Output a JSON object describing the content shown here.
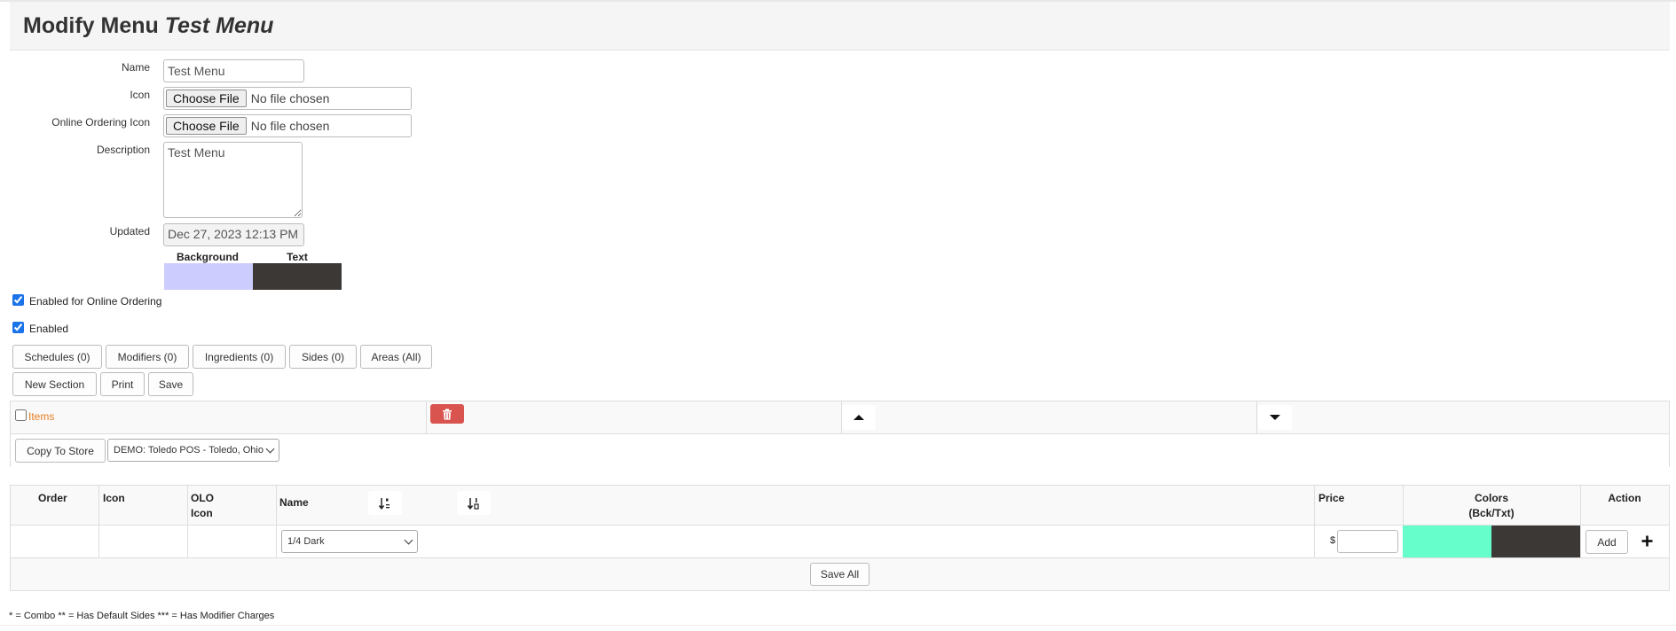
{
  "header": {
    "title_prefix": "Modify Menu",
    "title_name": "Test Menu"
  },
  "form": {
    "name_label": "Name",
    "name_value": "Test Menu",
    "icon_label": "Icon",
    "icon_button": "Choose File",
    "icon_status": "No file chosen",
    "olo_icon_label": "Online Ordering Icon",
    "olo_icon_button": "Choose File",
    "olo_icon_status": "No file chosen",
    "description_label": "Description",
    "description_value": "Test Menu",
    "updated_label": "Updated",
    "updated_value": "Dec 27, 2023 12:13 PM"
  },
  "colors": {
    "background_label": "Background",
    "text_label": "Text",
    "background": "#ccccff",
    "text": "#3b3835"
  },
  "checkboxes": {
    "online_ordering": {
      "label": "Enabled for Online Ordering",
      "checked": true
    },
    "enabled": {
      "label": "Enabled",
      "checked": true
    }
  },
  "tabs": [
    "Schedules (0)",
    "Modifiers (0)",
    "Ingredients (0)",
    "Sides (0)",
    "Areas (All)"
  ],
  "actions": [
    "New Section",
    "Print",
    "Save"
  ],
  "section": {
    "title": "Items",
    "delete_icon": "trash-icon",
    "delete_color": "#d9534f",
    "up_icon": "caret-up-icon",
    "down_icon": "caret-down-icon",
    "copy_button": "Copy To Store",
    "store_selected": "DEMO: Toledo POS - Toledo, Ohio"
  },
  "table": {
    "headers": {
      "order": "Order",
      "icon": "Icon",
      "olo_line1": "OLO",
      "olo_line2": "Icon",
      "name": "Name",
      "price": "Price",
      "colors_line1": "Colors",
      "colors_line2": "(Bck/Txt)",
      "action": "Action"
    },
    "sort_icons": [
      "sort-alpha-icon",
      "sort-numeric-icon"
    ],
    "new_row": {
      "item_selected": "1/4 Dark",
      "currency": "$",
      "price_value": "",
      "bg_color": "#66ffcc",
      "text_color": "#3b3835",
      "add_button": "Add",
      "plus_icon": "plus-icon"
    },
    "save_all": "Save All"
  },
  "footnote": "* = Combo ** = Has Default Sides *** = Has Modifier Charges"
}
